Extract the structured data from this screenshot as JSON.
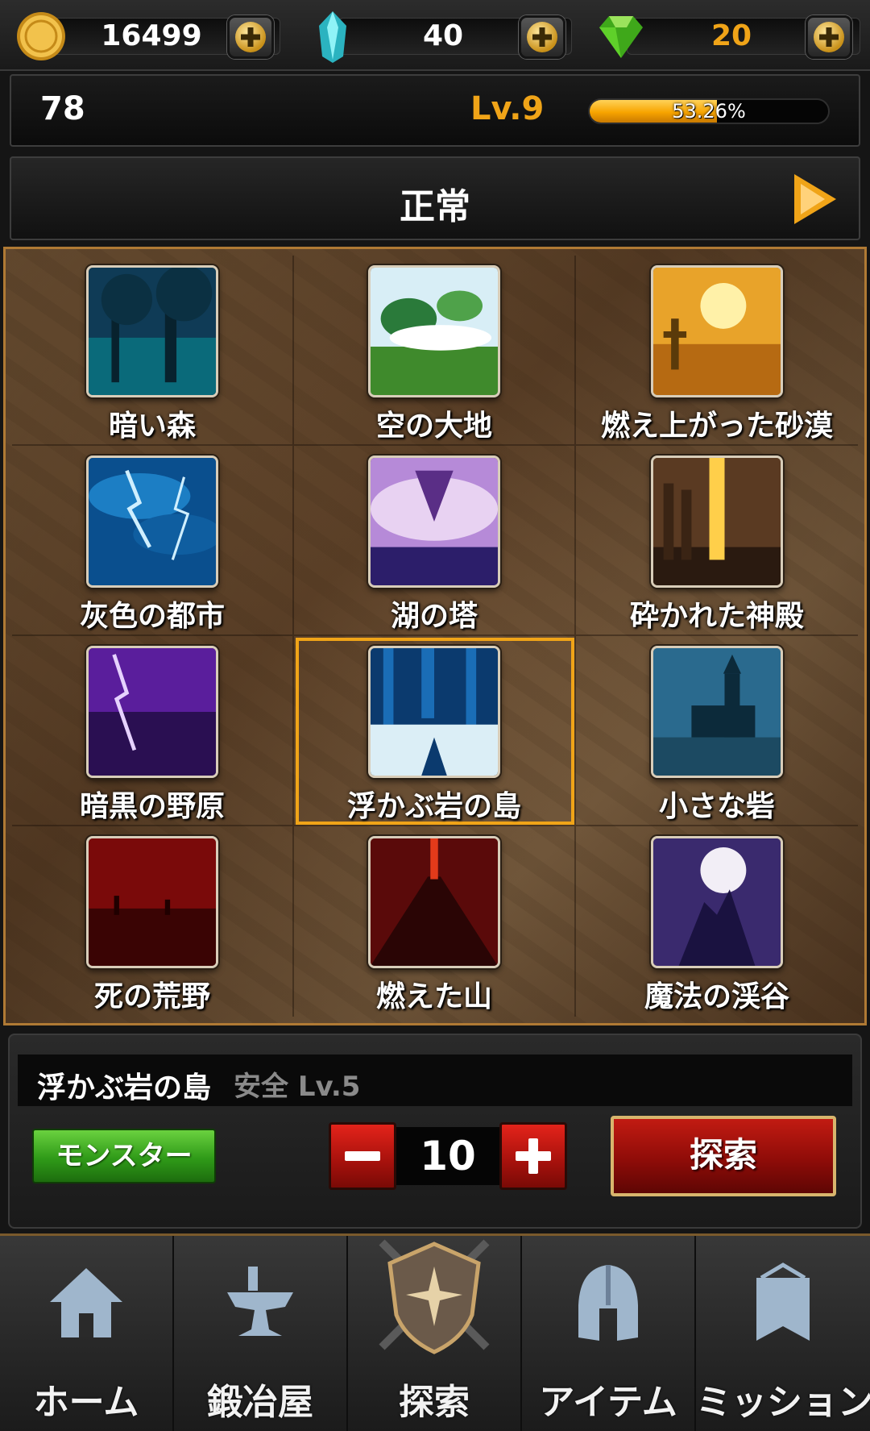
{
  "currency": {
    "gold": "16499",
    "crystal": "40",
    "gem": "20"
  },
  "player": {
    "value": "78",
    "level": "Lv.9",
    "xp_percent": "53.26%"
  },
  "status": {
    "title": "正常"
  },
  "areas": [
    {
      "name": "暗い森"
    },
    {
      "name": "空の大地"
    },
    {
      "name": "燃え上がった砂漠"
    },
    {
      "name": "灰色の都市"
    },
    {
      "name": "湖の塔"
    },
    {
      "name": "砕かれた神殿"
    },
    {
      "name": "暗黒の野原"
    },
    {
      "name": "浮かぶ岩の島"
    },
    {
      "name": "小さな砦"
    },
    {
      "name": "死の荒野"
    },
    {
      "name": "燃えた山"
    },
    {
      "name": "魔法の渓谷"
    }
  ],
  "selected_index": 7,
  "detail": {
    "name": "浮かぶ岩の島",
    "meta": "安全 Lv.5",
    "monster_button": "モンスター",
    "count": "10",
    "explore_button": "探索"
  },
  "nav": {
    "tabs": [
      {
        "label": "ホーム"
      },
      {
        "label": "鍛冶屋"
      },
      {
        "label": "探索"
      },
      {
        "label": "アイテム"
      },
      {
        "label": "ミッション"
      }
    ]
  },
  "colors": {
    "accent": "#f0a418",
    "monster_green": "#2f9a18",
    "explore_red": "#8f0c08"
  }
}
